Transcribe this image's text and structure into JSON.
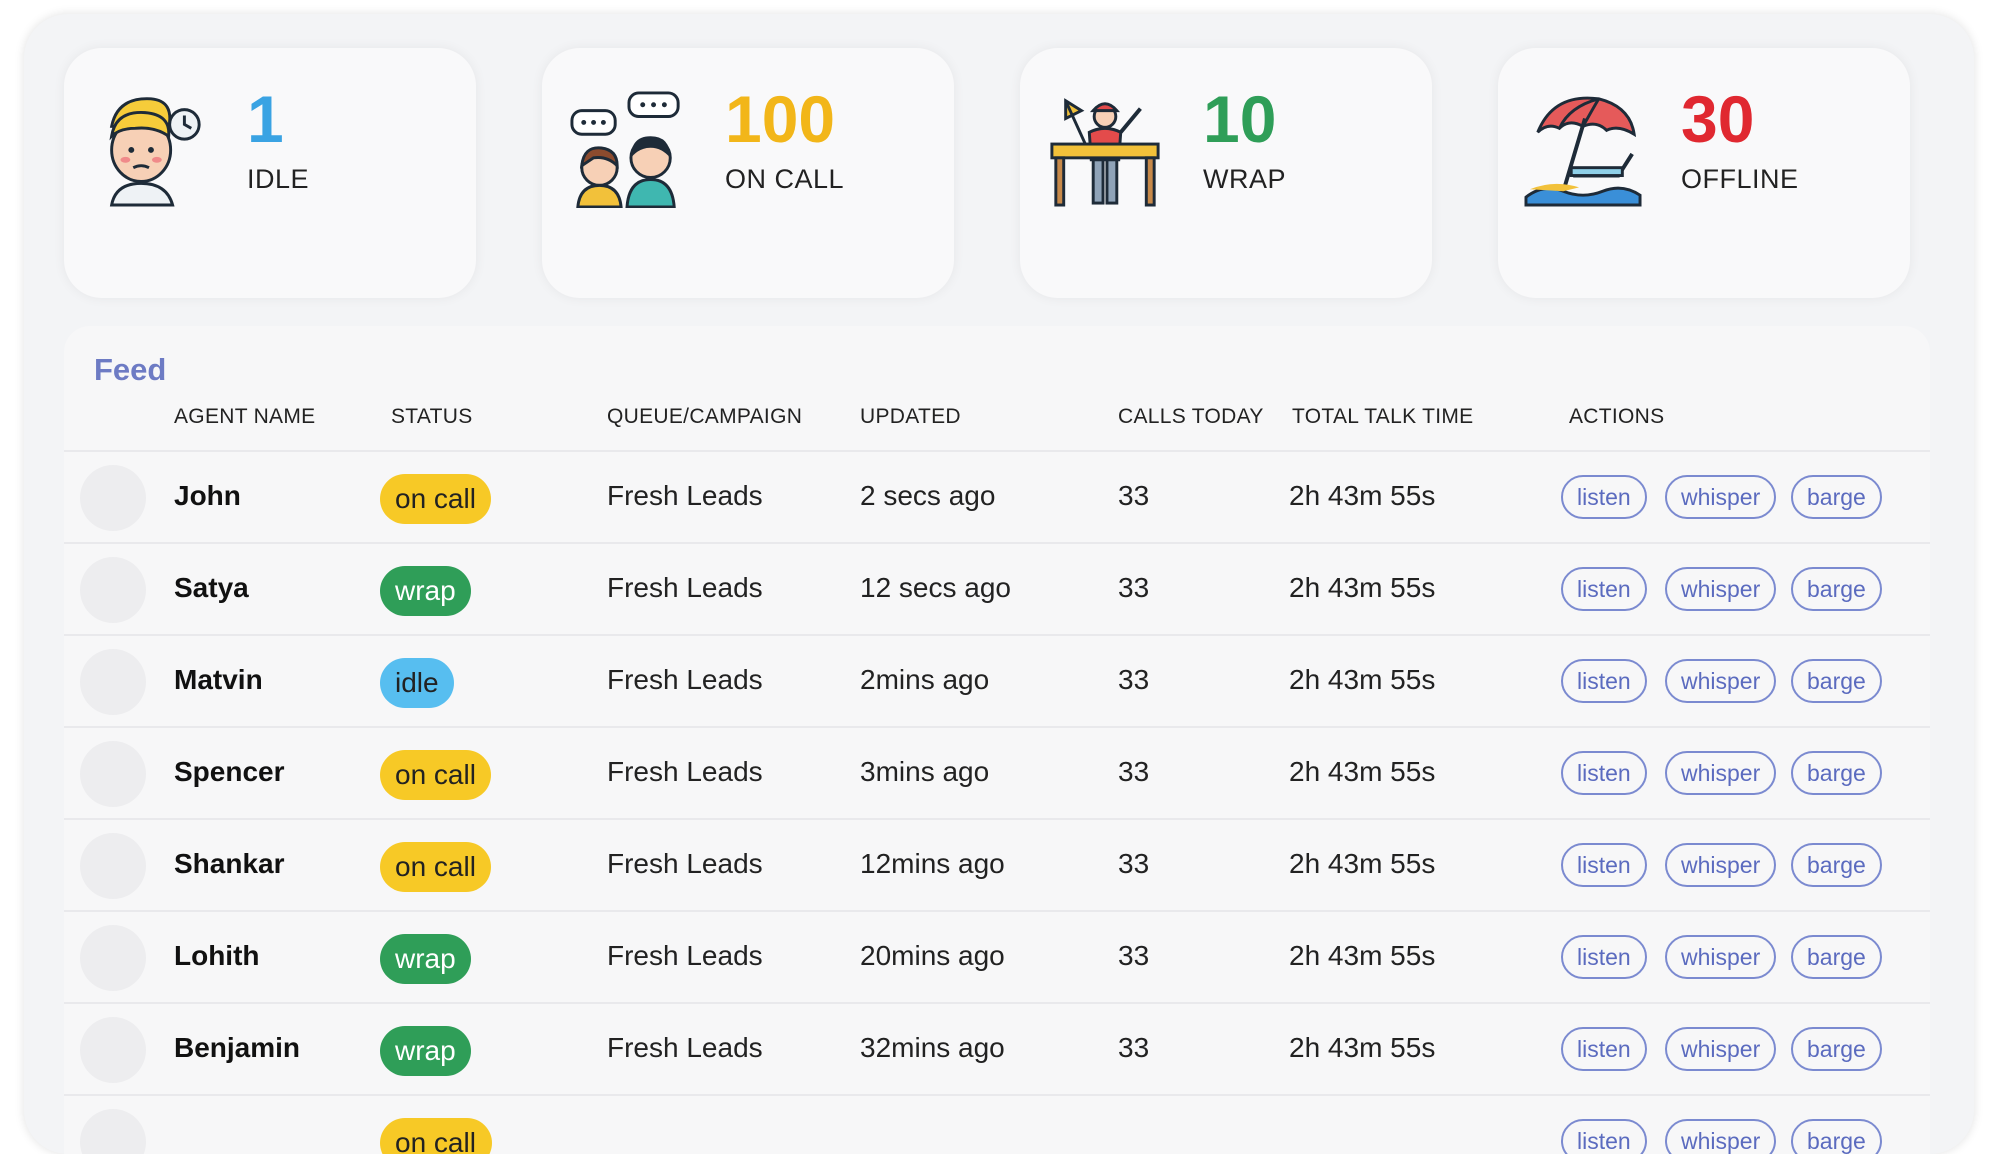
{
  "stats": [
    {
      "value": "1",
      "label": "IDLE",
      "color": "#3aa3e3",
      "icon": "stopwatch-person-icon"
    },
    {
      "value": "100",
      "label": "ON CALL",
      "color": "#f2b619",
      "icon": "chatting-people-icon"
    },
    {
      "value": "10",
      "label": "WRAP",
      "color": "#2f9e58",
      "icon": "finish-line-icon"
    },
    {
      "value": "30",
      "label": "OFFLINE",
      "color": "#e02830",
      "icon": "beach-umbrella-icon"
    }
  ],
  "feed": {
    "title": "Feed",
    "columns": [
      "AGENT NAME",
      "STATUS",
      "QUEUE/CAMPAIGN",
      "UPDATED",
      "CALLS TODAY",
      "TOTAL TALK TIME",
      "ACTIONS"
    ],
    "actions": [
      "listen",
      "whisper",
      "barge"
    ],
    "rows": [
      {
        "name": "John",
        "status": "on call",
        "queue": "Fresh Leads",
        "updated": "2 secs ago",
        "calls": "33",
        "talk": "2h 43m 55s"
      },
      {
        "name": "Satya",
        "status": "wrap",
        "queue": "Fresh Leads",
        "updated": "12 secs ago",
        "calls": "33",
        "talk": "2h 43m 55s"
      },
      {
        "name": "Matvin",
        "status": "idle",
        "queue": "Fresh Leads",
        "updated": "2mins ago",
        "calls": "33",
        "talk": "2h 43m 55s"
      },
      {
        "name": "Spencer",
        "status": "on call",
        "queue": "Fresh Leads",
        "updated": "3mins ago",
        "calls": "33",
        "talk": "2h 43m 55s"
      },
      {
        "name": "Shankar",
        "status": "on call",
        "queue": "Fresh Leads",
        "updated": "12mins ago",
        "calls": "33",
        "talk": "2h 43m 55s"
      },
      {
        "name": "Lohith",
        "status": "wrap",
        "queue": "Fresh Leads",
        "updated": "20mins ago",
        "calls": "33",
        "talk": "2h 43m 55s"
      },
      {
        "name": "Benjamin",
        "status": "wrap",
        "queue": "Fresh Leads",
        "updated": "32mins ago",
        "calls": "33",
        "talk": "2h 43m 55s"
      },
      {
        "name": "",
        "status": "on call",
        "queue": "",
        "updated": "",
        "calls": "",
        "talk": ""
      }
    ]
  }
}
